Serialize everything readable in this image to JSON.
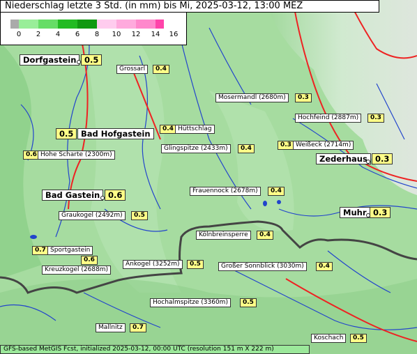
{
  "title": "Niederschlag letzte 3 Std. (in mm) bis Mi, 2025-03-12, 13:00 MEZ",
  "legend": {
    "ticks": [
      "0",
      "2",
      "4",
      "6",
      "8",
      "10",
      "12",
      "14",
      "16"
    ],
    "colors": [
      "#aaaaaa",
      "#99ee99",
      "#66dd66",
      "#22bb22",
      "#119911",
      "#ffccee",
      "#ffaadd",
      "#ff88cc",
      "#ff44aa"
    ]
  },
  "places": [
    {
      "name": "Dorfgastein",
      "value": "0.5"
    },
    {
      "name": "Grossarl",
      "value": "0.4"
    },
    {
      "name": "Mosermandl (2680m)",
      "value": "0.3"
    },
    {
      "name": "Hochfeind (2887m)",
      "value": "0.3"
    },
    {
      "name": "Bad Hofgastein",
      "value": "0.5"
    },
    {
      "name": "Hüttschlag",
      "value": "0.4"
    },
    {
      "name": "Hohe Scharte (2300m)",
      "value": "0.6"
    },
    {
      "name": "Glingspitze (2433m)",
      "value": "0.4"
    },
    {
      "name": "Weißeck (2714m)",
      "value": "0.3"
    },
    {
      "name": "Zederhaus",
      "value": "0.3"
    },
    {
      "name": "Bad Gastein",
      "value": "0.6"
    },
    {
      "name": "Frauennock (2678m)",
      "value": "0.4"
    },
    {
      "name": "Graukogel (2492m)",
      "value": "0.5"
    },
    {
      "name": "Muhr",
      "value": "0.3"
    },
    {
      "name": "Kölnbreinsperre",
      "value": "0.4"
    },
    {
      "name": "Sportgastein",
      "value": "0.7"
    },
    {
      "name": "Kreuzkogel (2688m)",
      "value": "0.6"
    },
    {
      "name": "Ankogel (3252m)",
      "value": "0.5"
    },
    {
      "name": "Großer Sonnblick (3030m)",
      "value": "0.4"
    },
    {
      "name": "Hochalmspitze (3360m)",
      "value": "0.5"
    },
    {
      "name": "Mallnitz",
      "value": "0.7"
    },
    {
      "name": "Koschach",
      "value": "0.5"
    }
  ],
  "footer": "GFS-based MetGIS Fcst, initialized 2025-03-12, 00:00 UTC  (resolution 151 m X 222 m)"
}
